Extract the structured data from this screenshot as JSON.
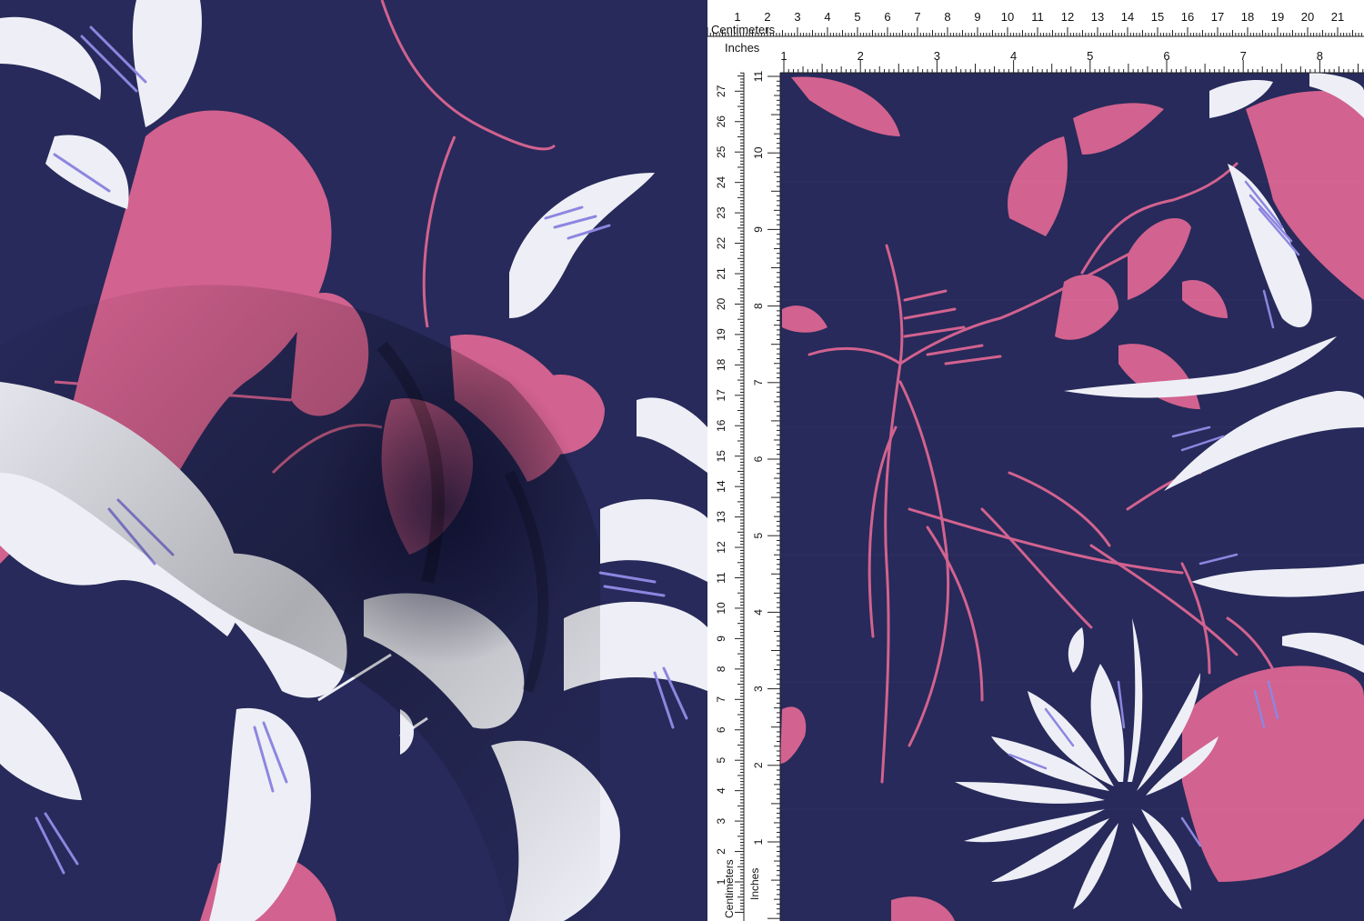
{
  "colors": {
    "navy": "#272a5a",
    "pink": "#d2628f",
    "white": "#eeeff6",
    "lavender": "#8d86e0",
    "ruler": "#ffffff",
    "tick": "#222222"
  },
  "ruler_top": {
    "cm_label": "Centimeters",
    "in_label": "Inches",
    "cm_numbers": [
      "1",
      "2",
      "3",
      "4",
      "5",
      "6",
      "7",
      "8",
      "9",
      "10",
      "11",
      "12",
      "13",
      "14",
      "15",
      "16",
      "17",
      "18",
      "19",
      "20",
      "21"
    ],
    "in_numbers": [
      "1",
      "2",
      "3",
      "4",
      "5",
      "6",
      "7",
      "8"
    ]
  },
  "ruler_left": {
    "cm_label": "Centimeters",
    "in_label": "Inches",
    "cm_numbers": [
      "1",
      "2",
      "3",
      "4",
      "5",
      "6",
      "7",
      "8",
      "9",
      "10",
      "11",
      "12",
      "13",
      "14",
      "15",
      "16",
      "17",
      "18",
      "19",
      "20",
      "21",
      "22",
      "23",
      "24",
      "25",
      "26",
      "27"
    ],
    "in_numbers": [
      "1",
      "2",
      "3",
      "4",
      "5",
      "6",
      "7",
      "8",
      "9",
      "10",
      "11"
    ]
  }
}
